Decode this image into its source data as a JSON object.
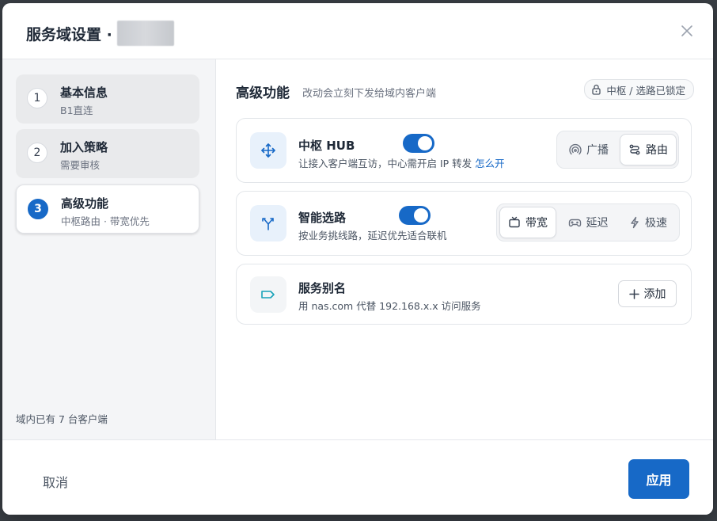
{
  "dialog": {
    "title": "服务域设置 ·",
    "close_icon": "close-icon"
  },
  "sidebar": {
    "steps": [
      {
        "number": "1",
        "title": "基本信息",
        "subtitle": "B1直连",
        "active": false
      },
      {
        "number": "2",
        "title": "加入策略",
        "subtitle": "需要审核",
        "active": false
      },
      {
        "number": "3",
        "title": "高级功能",
        "subtitle": "中枢路由 · 带宽优先",
        "active": true
      }
    ],
    "footer_text": "域内已有 7 台客户端"
  },
  "main": {
    "title": "高级功能",
    "description": "改动会立刻下发给域内客户端",
    "lock_badge": "中枢 / 选路已锁定",
    "cards": [
      {
        "name": "中枢 HUB",
        "description": "让接入客户端互访，中心需开启 IP 转发",
        "link": "怎么开",
        "icon": "hub-arrows-icon",
        "toggle_on": true,
        "options": [
          {
            "label": "广播",
            "icon": "broadcast-icon",
            "selected": false
          },
          {
            "label": "路由",
            "icon": "route-icon",
            "selected": true
          }
        ]
      },
      {
        "name": "智能选路",
        "description": "按业务挑线路，延迟优先适合联机",
        "icon": "split-route-icon",
        "toggle_on": true,
        "options": [
          {
            "label": "带宽",
            "icon": "tv-icon",
            "selected": true
          },
          {
            "label": "延迟",
            "icon": "gamepad-icon",
            "selected": false
          },
          {
            "label": "极速",
            "icon": "lightning-icon",
            "selected": false
          }
        ]
      },
      {
        "name": "服务别名",
        "description": "用 nas.com 代替 192.168.x.x 访问服务",
        "icon": "tag-icon",
        "button": "添加"
      }
    ]
  },
  "footer": {
    "cancel": "取消",
    "apply": "应用"
  },
  "colors": {
    "accent": "#1769c7",
    "tag_accent": "#17a2b8"
  }
}
